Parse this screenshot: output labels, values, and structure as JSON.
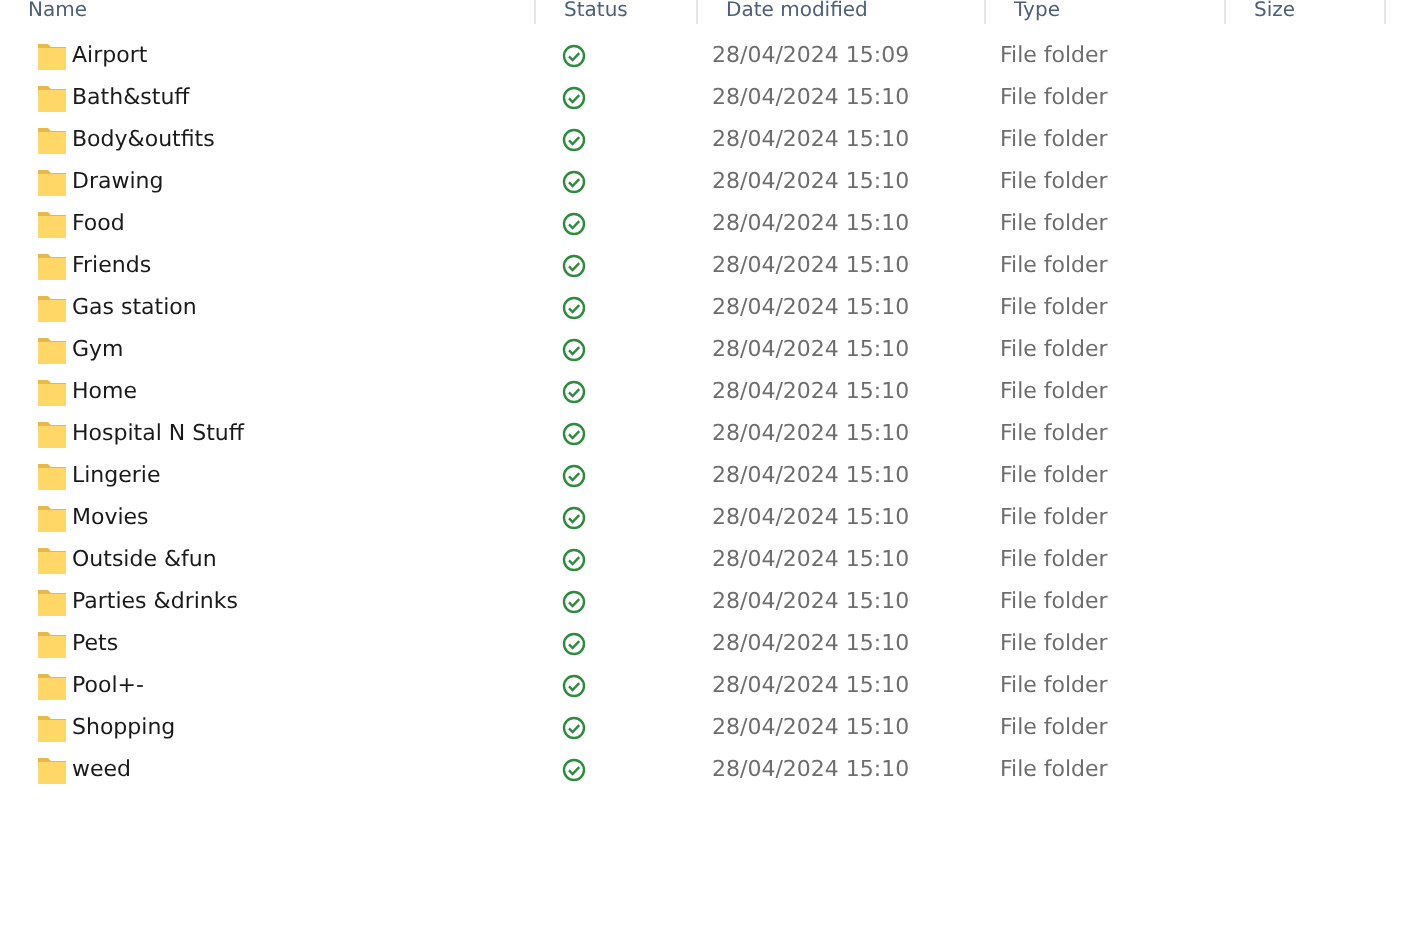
{
  "columns": [
    "Name",
    "Status",
    "Date modified",
    "Type",
    "Size"
  ],
  "rows": [
    {
      "name": "Airport",
      "synced": true,
      "date": "28/04/2024 15:09",
      "type": "File folder"
    },
    {
      "name": "Bath&stuff",
      "synced": true,
      "date": "28/04/2024 15:10",
      "type": "File folder"
    },
    {
      "name": "Body&outfits",
      "synced": true,
      "date": "28/04/2024 15:10",
      "type": "File folder"
    },
    {
      "name": "Drawing",
      "synced": true,
      "date": "28/04/2024 15:10",
      "type": "File folder"
    },
    {
      "name": "Food",
      "synced": true,
      "date": "28/04/2024 15:10",
      "type": "File folder"
    },
    {
      "name": "Friends",
      "synced": true,
      "date": "28/04/2024 15:10",
      "type": "File folder"
    },
    {
      "name": "Gas station",
      "synced": true,
      "date": "28/04/2024 15:10",
      "type": "File folder"
    },
    {
      "name": "Gym",
      "synced": true,
      "date": "28/04/2024 15:10",
      "type": "File folder"
    },
    {
      "name": "Home",
      "synced": true,
      "date": "28/04/2024 15:10",
      "type": "File folder"
    },
    {
      "name": "Hospital N Stuff",
      "synced": true,
      "date": "28/04/2024 15:10",
      "type": "File folder"
    },
    {
      "name": "Lingerie",
      "synced": true,
      "date": "28/04/2024 15:10",
      "type": "File folder"
    },
    {
      "name": "Movies",
      "synced": true,
      "date": "28/04/2024 15:10",
      "type": "File folder"
    },
    {
      "name": "Outside &fun",
      "synced": true,
      "date": "28/04/2024 15:10",
      "type": "File folder"
    },
    {
      "name": "Parties &drinks",
      "synced": true,
      "date": "28/04/2024 15:10",
      "type": "File folder"
    },
    {
      "name": "Pets",
      "synced": true,
      "date": "28/04/2024 15:10",
      "type": "File folder"
    },
    {
      "name": "Pool+-",
      "synced": true,
      "date": "28/04/2024 15:10",
      "type": "File folder"
    },
    {
      "name": "Shopping",
      "synced": true,
      "date": "28/04/2024 15:10",
      "type": "File folder"
    },
    {
      "name": "weed",
      "synced": true,
      "date": "28/04/2024 15:10",
      "type": "File folder"
    }
  ]
}
